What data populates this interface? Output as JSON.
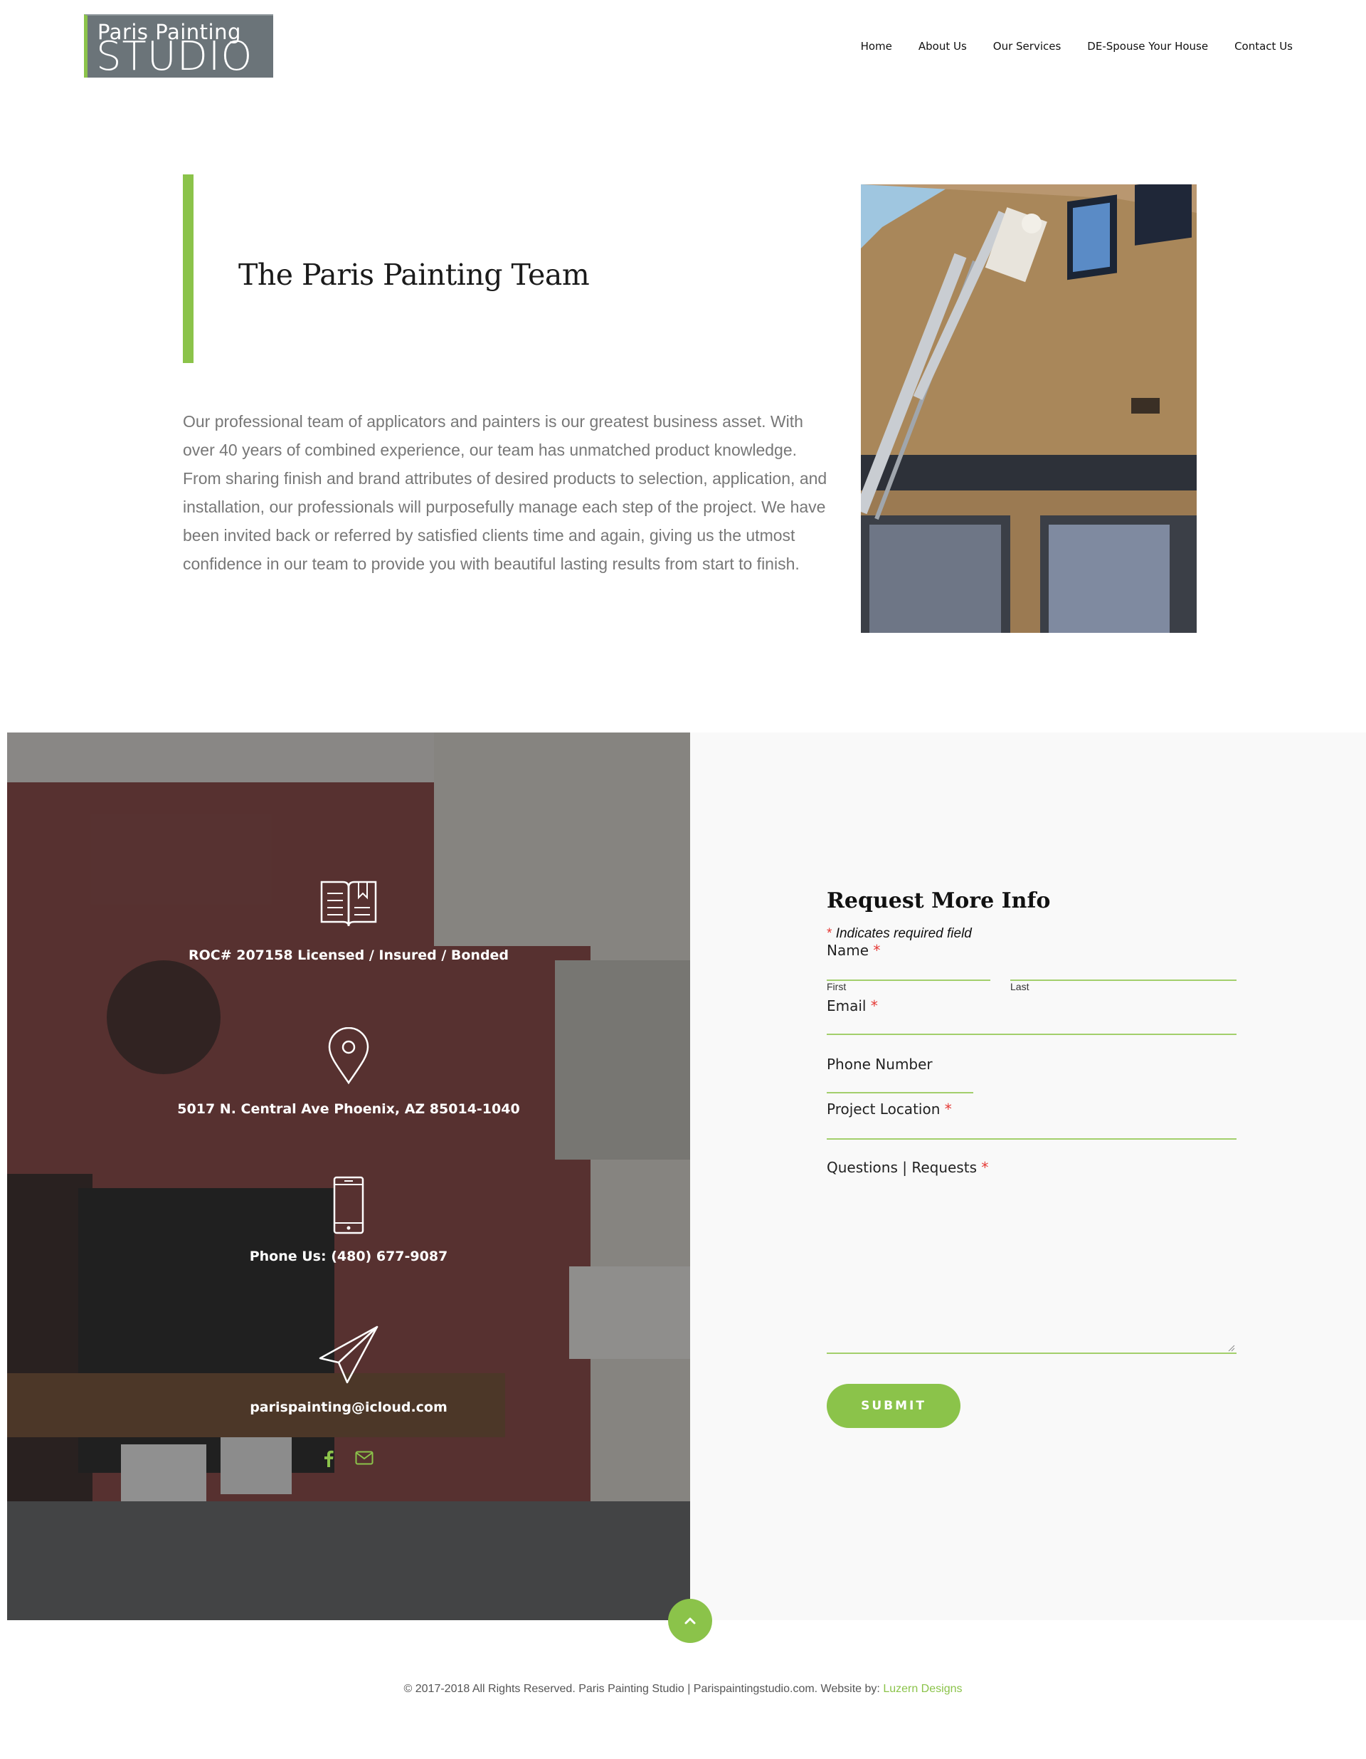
{
  "header": {
    "logo_line1": "Paris Painting",
    "logo_line2": "STUDIO",
    "nav": [
      "Home",
      "About Us",
      "Our Services",
      "DE-Spouse Your House",
      "Contact Us"
    ]
  },
  "team": {
    "title": "The Paris Painting Team",
    "body": "Our professional team of applicators and painters is our greatest business asset.  With over 40 years of combined experience, our team has unmatched product knowledge. From sharing finish and brand attributes of desired products to selection, application, and installation, our professionals will purposefully manage each step of the project. We have been invited back or referred by satisfied clients time and again, giving us the utmost confidence in our team to provide you with beautiful lasting results from start to finish."
  },
  "contact_info": {
    "license": "ROC# 207158 Licensed / Insured / Bonded",
    "address": "5017 N. Central Ave Phoenix, AZ 85014-1040",
    "phone": "Phone Us: (480) 677-9087",
    "email": "parispainting@icloud.com",
    "social_icons": [
      "facebook-icon",
      "mail-icon"
    ]
  },
  "form": {
    "title": "Request More Info",
    "required_star": "*",
    "required_note": "Indicates required field",
    "name_label": "Name",
    "first_label": "First",
    "last_label": "Last",
    "email_label": "Email",
    "phone_label": "Phone Number",
    "location_label": "Project Location",
    "questions_label": "Questions | Requests",
    "submit_label": "SUBMIT"
  },
  "footer": {
    "text": "© 2017-2018 All Rights Reserved. Paris Painting Studio | Parispaintingstudio.com. Website by:",
    "credit": "Luzern Designs"
  },
  "colors": {
    "accent": "#8bc34a",
    "required": "#e53935"
  }
}
